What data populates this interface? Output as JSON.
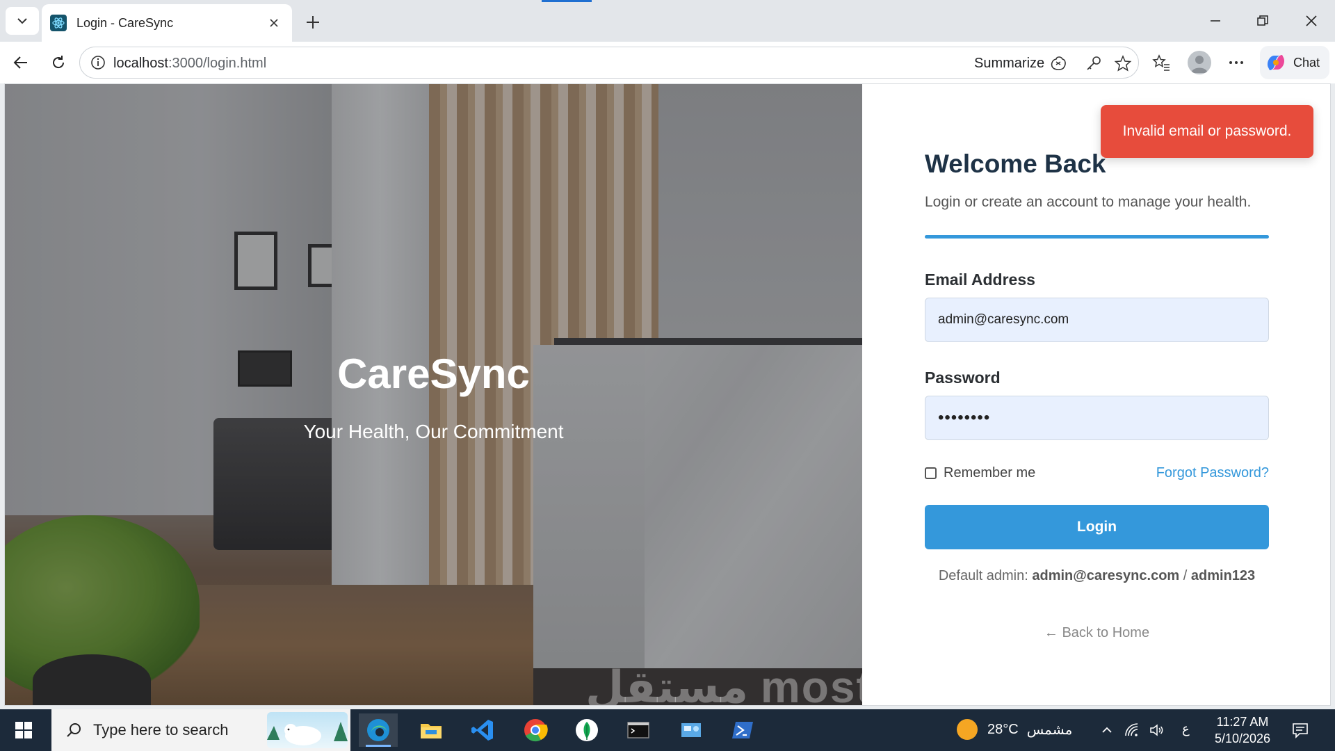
{
  "browser": {
    "tab_title": "Login - CareSync",
    "url_host": "localhost",
    "url_path": ":3000/login.html",
    "summarize_label": "Summarize",
    "chat_label": "Chat"
  },
  "hero": {
    "title": "CareSync",
    "subtitle": "Your Health, Our Commitment",
    "watermark": "مستقل mostaql.com"
  },
  "toast": {
    "message": "Invalid email or password.",
    "color": "#e74c3c"
  },
  "form": {
    "heading": "Welcome Back",
    "subtitle": "Login or create an account to manage your health.",
    "email_label": "Email Address",
    "email_value": "admin@caresync.com",
    "password_label": "Password",
    "password_value": "admin123",
    "remember_label": "Remember me",
    "forgot_label": "Forgot Password?",
    "login_label": "Login",
    "default_prefix": "Default admin:",
    "default_email": "admin@caresync.com",
    "default_separator": "/",
    "default_password": "admin123",
    "back_home_label": "← Back to Home",
    "accent_color": "#3498db"
  },
  "taskbar": {
    "search_placeholder": "Type here to search",
    "weather_temp": "28°C",
    "weather_desc": "مشمس",
    "input_lang": "ع",
    "time": "11:27 AM",
    "date": "5/10/2026"
  }
}
